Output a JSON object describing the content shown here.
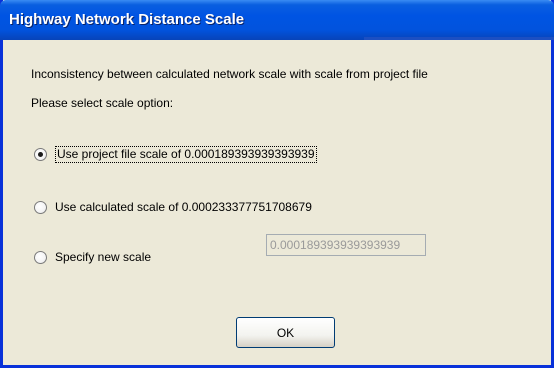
{
  "window": {
    "title": "Highway Network Distance Scale"
  },
  "message": {
    "line1": "Inconsistency between calculated network scale with scale from project file",
    "line2": "Please select scale option:"
  },
  "options": [
    {
      "label": "Use project file scale of 0.000189393939393939",
      "selected": true
    },
    {
      "label": "Use calculated scale of 0.000233377751708679",
      "selected": false
    },
    {
      "label": "Specify new scale",
      "selected": false
    }
  ],
  "new_scale": {
    "value": "0.000189393939393939",
    "enabled": false
  },
  "buttons": {
    "ok_label": "OK"
  },
  "colors": {
    "titlebar": "#0054E3",
    "frame": "#0831D9",
    "dialog_bg": "#ECE9D8"
  }
}
